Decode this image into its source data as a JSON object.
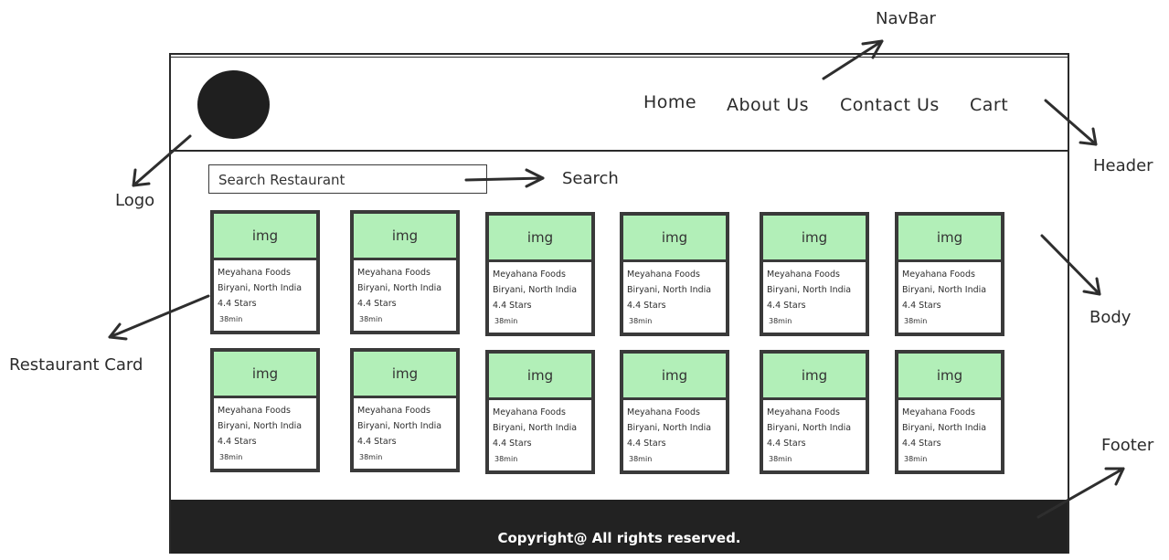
{
  "annotations": {
    "navbar": "NavBar",
    "header": "Header",
    "logo": "Logo",
    "search": "Search",
    "restaurant_card": "Restaurant Card",
    "body": "Body",
    "footer": "Footer"
  },
  "header": {
    "nav": [
      "Home",
      "About Us",
      "Contact Us",
      "Cart"
    ]
  },
  "search": {
    "placeholder": "Search Restaurant"
  },
  "cards": [
    {
      "img": "img",
      "name": "Meyahana Foods",
      "cuisine": "Biryani, North India",
      "rating": "4.4 Stars",
      "time": "38min"
    },
    {
      "img": "img",
      "name": "Meyahana Foods",
      "cuisine": "Biryani, North India",
      "rating": "4.4 Stars",
      "time": "38min"
    },
    {
      "img": "img",
      "name": "Meyahana Foods",
      "cuisine": "Biryani, North India",
      "rating": "4.4 Stars",
      "time": "38min"
    },
    {
      "img": "img",
      "name": "Meyahana Foods",
      "cuisine": "Biryani, North India",
      "rating": "4.4 Stars",
      "time": "38min"
    },
    {
      "img": "img",
      "name": "Meyahana Foods",
      "cuisine": "Biryani, North India",
      "rating": "4.4 Stars",
      "time": "38min"
    },
    {
      "img": "img",
      "name": "Meyahana Foods",
      "cuisine": "Biryani, North India",
      "rating": "4.4 Stars",
      "time": "38min"
    },
    {
      "img": "img",
      "name": "Meyahana Foods",
      "cuisine": "Biryani, North India",
      "rating": "4.4 Stars",
      "time": "38min"
    },
    {
      "img": "img",
      "name": "Meyahana Foods",
      "cuisine": "Biryani, North India",
      "rating": "4.4 Stars",
      "time": "38min"
    },
    {
      "img": "img",
      "name": "Meyahana Foods",
      "cuisine": "Biryani, North India",
      "rating": "4.4 Stars",
      "time": "38min"
    },
    {
      "img": "img",
      "name": "Meyahana Foods",
      "cuisine": "Biryani, North India",
      "rating": "4.4 Stars",
      "time": "38min"
    },
    {
      "img": "img",
      "name": "Meyahana Foods",
      "cuisine": "Biryani, North India",
      "rating": "4.4 Stars",
      "time": "38min"
    },
    {
      "img": "img",
      "name": "Meyahana Foods",
      "cuisine": "Biryani, North India",
      "rating": "4.4 Stars",
      "time": "38min"
    }
  ],
  "footer": {
    "text": "Copyright@ All rights reserved."
  },
  "colors": {
    "card_image_fill": "#b2efb8",
    "footer_bg": "#222222",
    "logo_fill": "#1f1f1f",
    "ink": "#2e2e2e"
  }
}
